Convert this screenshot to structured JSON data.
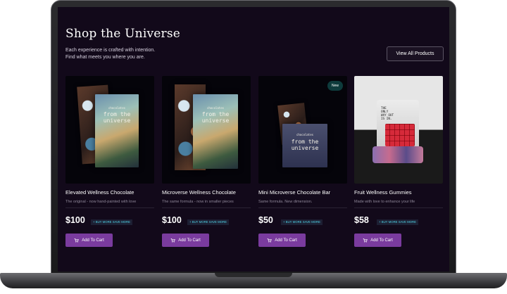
{
  "header": {
    "title": "Shop the Universe",
    "subtitle_line1": "Each experience is crafted with intention.",
    "subtitle_line2": "Find what meets you where you are.",
    "view_all_label": "View All Products"
  },
  "products": [
    {
      "name": "Elevated Wellness Chocolate",
      "description": "The original - now hand-painted with love",
      "price": "$100",
      "badge": "+ BUY MORE SAVE MORE",
      "cart_label": "Add To Cart",
      "box_text_small": "chocolates",
      "box_text_1": "from the",
      "box_text_2": "universe"
    },
    {
      "name": "Microverse Wellness Chocolate",
      "description": "The same formula - now in smaller pieces",
      "price": "$100",
      "badge": "+ BUY MORE SAVE MORE",
      "cart_label": "Add To Cart",
      "box_text_small": "chocolates",
      "box_text_1": "from the",
      "box_text_2": "universe"
    },
    {
      "name": "Mini Microverse Chocolate Bar",
      "description": "Same formula. New dimension.",
      "price": "$50",
      "badge": "+ BUY MORE SAVE MORE",
      "cart_label": "Add To Cart",
      "new_label": "New",
      "box_text_small": "chocolates",
      "box_text_1": "from the",
      "box_text_2": "universe"
    },
    {
      "name": "Fruit Wellness Gummies",
      "description": "Made with love to enhance your life",
      "price": "$58",
      "badge": "+ BUY MORE SAVE MORE",
      "cart_label": "Add To Cart",
      "tin_text": [
        "THE",
        "ONLY",
        "WAY OUT",
        "IS IN."
      ]
    }
  ],
  "colors": {
    "screen_bg": "#12091a",
    "accent_cart": "#7a3b9e",
    "badge_text": "#4fd3e6",
    "new_badge_bg": "#0e3b3c"
  },
  "icons": {
    "cart": "cart-icon"
  }
}
